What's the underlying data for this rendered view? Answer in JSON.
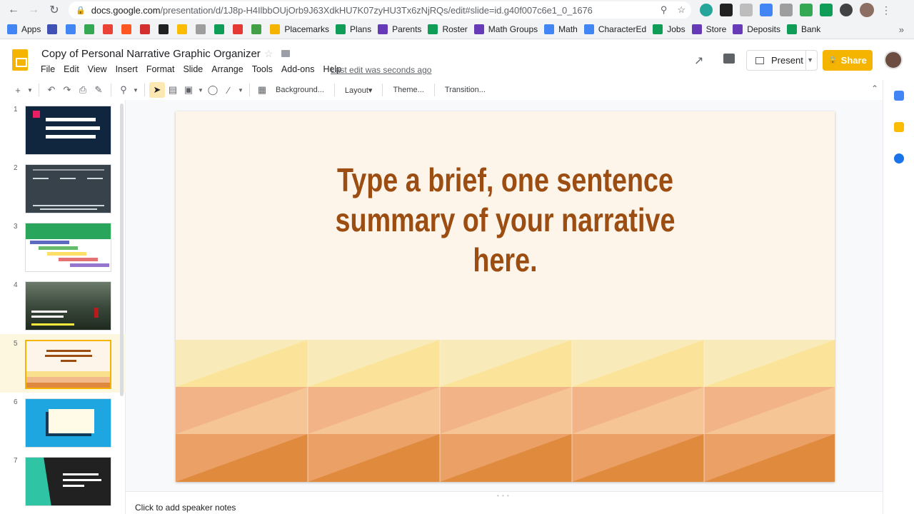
{
  "browser": {
    "url_host": "docs.google.com",
    "url_path": "/presentation/d/1J8p-H4IlbbOUjOrb9J63XdkHU7K07zyHU3Tx6zNjRQs/edit#slide=id.g40f007c6e1_0_1676"
  },
  "bookmarks": [
    {
      "label": "Apps",
      "color": "#4285f4"
    },
    {
      "label": "",
      "color": "#3f51b5"
    },
    {
      "label": "",
      "color": "#4285f4"
    },
    {
      "label": "",
      "color": "#34a853"
    },
    {
      "label": "",
      "color": "#ea4335"
    },
    {
      "label": "",
      "color": "#ff5722"
    },
    {
      "label": "",
      "color": "#d32f2f"
    },
    {
      "label": "",
      "color": "#212121"
    },
    {
      "label": "",
      "color": "#fbbc04"
    },
    {
      "label": "",
      "color": "#9e9e9e"
    },
    {
      "label": "",
      "color": "#0f9d58"
    },
    {
      "label": "",
      "color": "#e53935"
    },
    {
      "label": "",
      "color": "#43a047"
    },
    {
      "label": "Placemarks",
      "color": "#f4b400"
    },
    {
      "label": "Plans",
      "color": "#0f9d58"
    },
    {
      "label": "Parents",
      "color": "#673ab7"
    },
    {
      "label": "Roster",
      "color": "#0f9d58"
    },
    {
      "label": "Math Groups",
      "color": "#673ab7"
    },
    {
      "label": "Math",
      "color": "#4285f4"
    },
    {
      "label": "CharacterEd",
      "color": "#4285f4"
    },
    {
      "label": "Jobs",
      "color": "#0f9d58"
    },
    {
      "label": "Store",
      "color": "#673ab7"
    },
    {
      "label": "Deposits",
      "color": "#673ab7"
    },
    {
      "label": "Bank",
      "color": "#0f9d58"
    }
  ],
  "doc": {
    "title": "Copy of Personal Narrative Graphic Organizer",
    "last_edit": "Last edit was seconds ago",
    "menus": [
      "File",
      "Edit",
      "View",
      "Insert",
      "Format",
      "Slide",
      "Arrange",
      "Tools",
      "Add-ons",
      "Help"
    ]
  },
  "header": {
    "present_label": "Present",
    "share_label": "Share"
  },
  "toolbar": {
    "background": "Background...",
    "layout": "Layout",
    "theme": "Theme...",
    "transition": "Transition..."
  },
  "filmstrip": {
    "numbers": [
      "1",
      "2",
      "3",
      "4",
      "5",
      "6",
      "7"
    ],
    "selected": 5
  },
  "slide": {
    "title": "Type a brief, one sentence summary of your narrative here."
  },
  "notes": {
    "placeholder": "Click to add speaker notes"
  },
  "colors": {
    "accent": "#f4b400",
    "title_text": "#9c4d12",
    "slide_bg": "#fdf4ea"
  }
}
